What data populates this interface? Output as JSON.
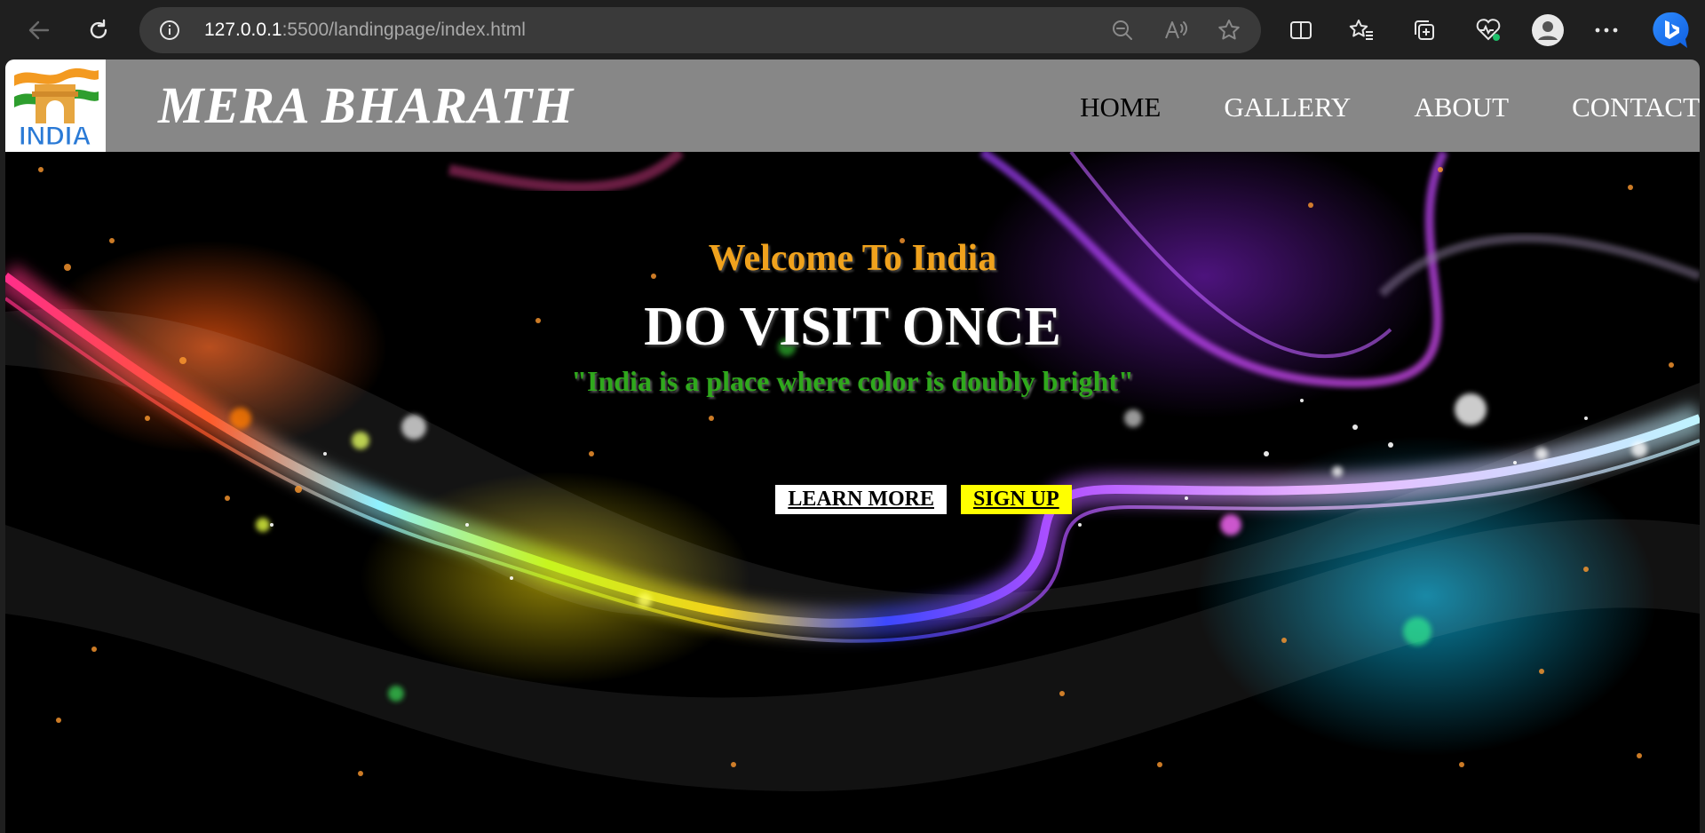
{
  "browser": {
    "url_host": "127.0.0.1",
    "url_rest": ":5500/landingpage/index.html",
    "icons": [
      "back-icon",
      "refresh-icon",
      "info-icon",
      "zoom-out-icon",
      "read-aloud-icon",
      "favorite-star-icon",
      "split-screen-icon",
      "favorites-icon",
      "collections-icon",
      "browser-health-icon",
      "profile-icon",
      "more-icon",
      "bing-icon"
    ]
  },
  "navbar": {
    "logo_text": "INDIA",
    "brand": "MERA BHARATH",
    "links": [
      {
        "label": "HOME",
        "active": true
      },
      {
        "label": "GALLERY",
        "active": false
      },
      {
        "label": "ABOUT",
        "active": false
      },
      {
        "label": "CONTACT",
        "active": false
      }
    ]
  },
  "hero": {
    "welcome": "Welcome To India",
    "headline": "DO VISIT ONCE",
    "quote": "\"India is a place where color is doubly bright\"",
    "learn_more": "LEARN MORE",
    "sign_up": "SIGN UP"
  },
  "colors": {
    "navbar_bg": "#878787",
    "welcome": "#f0a21d",
    "quote": "#2fa81c",
    "signup_bg": "#ffff00"
  }
}
